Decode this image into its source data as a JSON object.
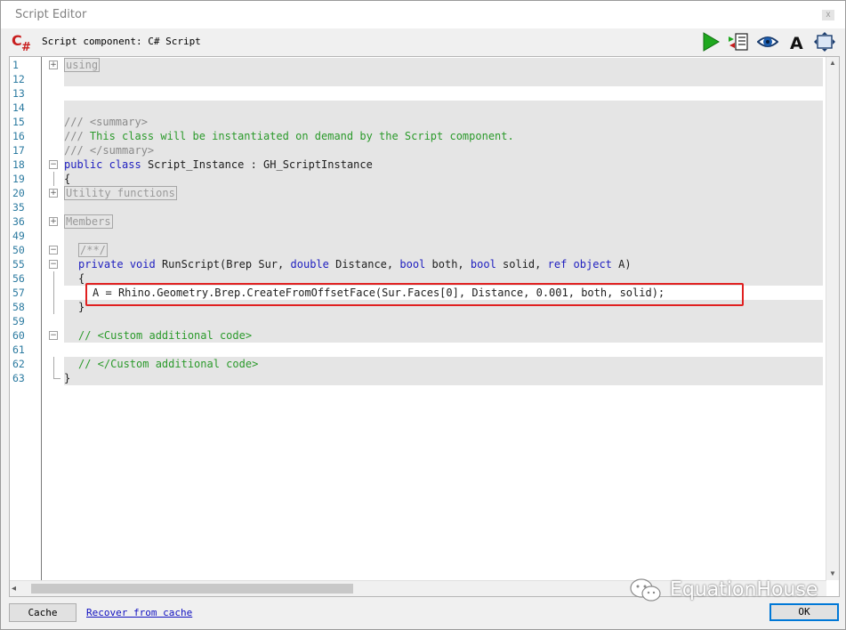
{
  "window": {
    "title": "Script Editor",
    "close_glyph": "x"
  },
  "toolbar": {
    "component_label": "Script component: C# Script",
    "logo_text": "C#",
    "icons": [
      "run-icon",
      "compile-log-icon",
      "preview-icon",
      "font-icon",
      "maximize-icon"
    ],
    "font_icon_text": "A"
  },
  "code": {
    "lines": [
      {
        "no": "1",
        "text": "using",
        "fold": "plus",
        "region": true,
        "hl": true
      },
      {
        "no": "12",
        "text": "",
        "hl": true
      },
      {
        "no": "13",
        "text": "",
        "hl": false
      },
      {
        "no": "14",
        "text": "",
        "hl": true
      },
      {
        "no": "15",
        "text": "/// <summary>",
        "hl": true
      },
      {
        "no": "16",
        "text": "/// This class will be instantiated on demand by the Script component.",
        "hl": true
      },
      {
        "no": "17",
        "text": "/// </summary>",
        "hl": true
      },
      {
        "no": "18",
        "text": "public class Script_Instance : GH_ScriptInstance",
        "fold": "minus",
        "hl": true
      },
      {
        "no": "19",
        "text": "{",
        "hl": true
      },
      {
        "no": "20",
        "text": "Utility functions",
        "fold": "plus",
        "region": true,
        "hl": true
      },
      {
        "no": "35",
        "text": "",
        "hl": true
      },
      {
        "no": "36",
        "text": "Members",
        "fold": "plus",
        "region": true,
        "hl": true
      },
      {
        "no": "49",
        "text": "",
        "hl": true
      },
      {
        "no": "50",
        "text": "/**/",
        "fold": "minus",
        "region": true,
        "hl": true
      },
      {
        "no": "55",
        "text": "private void RunScript(Brep Sur, double Distance, bool both, bool solid, ref object A)",
        "fold": "minus",
        "hl": true
      },
      {
        "no": "56",
        "text": "{",
        "hl": true
      },
      {
        "no": "57",
        "text": "A = Rhino.Geometry.Brep.CreateFromOffsetFace(Sur.Faces[0], Distance, 0.001, both, solid);",
        "hl": false
      },
      {
        "no": "58",
        "text": "}",
        "hl": true
      },
      {
        "no": "59",
        "text": "",
        "hl": true
      },
      {
        "no": "60",
        "text": "// <Custom additional code>",
        "fold": "minus",
        "hl": true
      },
      {
        "no": "61",
        "text": "",
        "hl": false
      },
      {
        "no": "62",
        "text": "// </Custom additional code>",
        "hl": true
      },
      {
        "no": "63",
        "text": "}",
        "hl": true
      }
    ]
  },
  "colors": {
    "keyword": "#2020c0",
    "comment": "#2b9a2b",
    "line_number": "#2b7aa0",
    "highlight_box": "#e02020"
  },
  "footer": {
    "cache_label": "Cache",
    "recover_label": "Recover from cache",
    "ok_label": "OK"
  },
  "watermark": {
    "text": "EquationHouse"
  }
}
